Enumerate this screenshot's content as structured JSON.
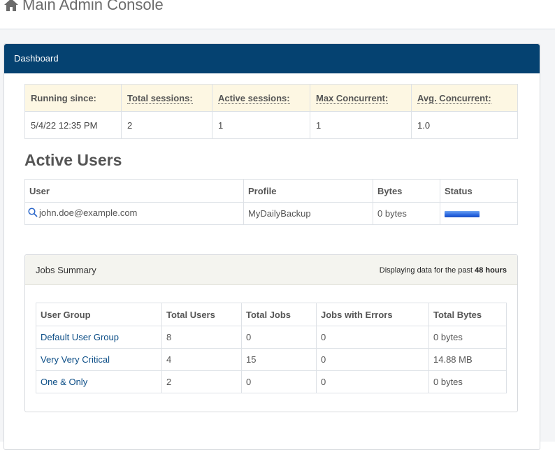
{
  "app": {
    "title": "Main Admin Console"
  },
  "panel": {
    "heading": "Dashboard"
  },
  "stats": {
    "headers": [
      "Running since:",
      "Total sessions:",
      "Active sessions:",
      "Max Concurrent:",
      "Avg. Concurrent:"
    ],
    "values": [
      "5/4/22 12:35 PM",
      "2",
      "1",
      "1",
      "1.0"
    ]
  },
  "active_users": {
    "title": "Active Users",
    "headers": [
      "User",
      "Profile",
      "Bytes",
      "Status"
    ],
    "rows": [
      {
        "user": "john.doe@example.com",
        "profile": "MyDailyBackup",
        "bytes": "0 bytes",
        "status_icon": "progress-bar"
      }
    ]
  },
  "jobs": {
    "title": "Jobs Summary",
    "note_prefix": "Displaying data for the past",
    "note_value": "48 hours",
    "headers": [
      "User Group",
      "Total Users",
      "Total Jobs",
      "Jobs with Errors",
      "Total Bytes"
    ],
    "rows": [
      [
        "Default User Group",
        "8",
        "0",
        "0",
        "0 bytes"
      ],
      [
        "Very Very Critical",
        "4",
        "15",
        "0",
        "14.88 MB"
      ],
      [
        "One & Only",
        "2",
        "0",
        "0",
        "0 bytes"
      ]
    ]
  },
  "colors": {
    "header_bar": "#054271",
    "link": "#0b4d86",
    "stats_header_bg": "#fdf7e3"
  }
}
